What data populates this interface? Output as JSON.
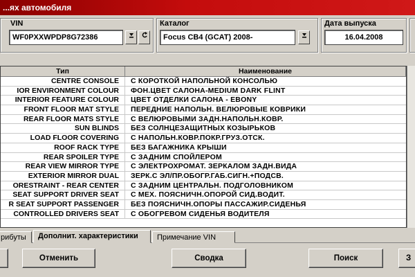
{
  "window": {
    "title": "...ях автомобиля"
  },
  "vin": {
    "label": "VIN",
    "value": "WF0PXXWPDP8G72386",
    "dropdown_icon": "dropdown-arrow-icon",
    "refresh_icon": "refresh-icon"
  },
  "catalog": {
    "label": "Каталог",
    "value": "Focus CB4 (GCAT) 2008-"
  },
  "release": {
    "label": "Дата выпуска",
    "value": "16.04.2008"
  },
  "grid": {
    "headers": {
      "type": "Тип",
      "name": "Наименование"
    },
    "rows": [
      {
        "type": "CENTRE CONSOLE",
        "name": "С КОРОТКОЙ НАПОЛЬНОЙ КОНСОЛЬЮ"
      },
      {
        "type": "IOR ENVIRONMENT COLOUR",
        "name": "ФОН.ЦВЕТ САЛОНА-MEDIUM DARK FLINT"
      },
      {
        "type": "INTERIOR FEATURE COLOUR",
        "name": "ЦВЕТ ОТДЕЛКИ САЛОНА - EBONY"
      },
      {
        "type": "FRONT FLOOR MAT STYLE",
        "name": "ПЕРЕДНИЕ НАПОЛЬН. ВЕЛЮРОВЫЕ КОВРИКИ"
      },
      {
        "type": "REAR FLOOR MATS STYLE",
        "name": "С ВЕЛЮРОВЫМИ ЗАДН.НАПОЛЬН.КОВР."
      },
      {
        "type": "SUN BLINDS",
        "name": "БЕЗ СОЛНЦЕЗАЩИТНЫХ КОЗЫРЬКОВ"
      },
      {
        "type": "LOAD FLOOR COVERING",
        "name": "С НАПОЛЬН.КОВР.ПОКР.ГРУЗ.ОТСК."
      },
      {
        "type": "ROOF RACK TYPE",
        "name": "БЕЗ БАГАЖНИКА КРЫШИ"
      },
      {
        "type": "REAR SPOILER TYPE",
        "name": "С ЗАДНИМ СПОЙЛЕРОМ"
      },
      {
        "type": "REAR VIEW MIRROR TYPE",
        "name": "С ЭЛЕКТРОХРОМАТ. ЗЕРКАЛОМ ЗАДН.ВИДА"
      },
      {
        "type": "EXTERIOR MIRROR DUAL",
        "name": "ЗЕРК.С ЭЛ/ПР.ОБОГР.ГАБ.СИГН.+ПОДСВ."
      },
      {
        "type": "ORESTRAINT - REAR CENTER",
        "name": "С ЗАДНИМ ЦЕНТРАЛЬН. ПОДГОЛОВНИКОМ"
      },
      {
        "type": "SEAT SUPPORT DRIVER SEAT",
        "name": "С МЕХ. ПОЯСНИЧН.ОПОРОЙ СИД.ВОДИТ."
      },
      {
        "type": "R SEAT SUPPORT PASSENGER",
        "name": "БЕЗ ПОЯСНИЧН.ОПОРЫ ПАССАЖИР.СИДЕНЬЯ"
      },
      {
        "type": "CONTROLLED DRIVERS SEAT",
        "name": "С ОБОГРЕВОМ СИДЕНЬЯ ВОДИТЕЛЯ"
      }
    ]
  },
  "tabs": [
    {
      "label": "рибуты"
    },
    {
      "label": "Дополнит. характеристики"
    },
    {
      "label": "Примечание VIN"
    }
  ],
  "buttons": {
    "cancel": "Отменить",
    "summary": "Сводка",
    "search": "Поиск",
    "last": "З"
  },
  "colors": {
    "titlebar": "#c40c0c",
    "face": "#d4d0c8"
  }
}
